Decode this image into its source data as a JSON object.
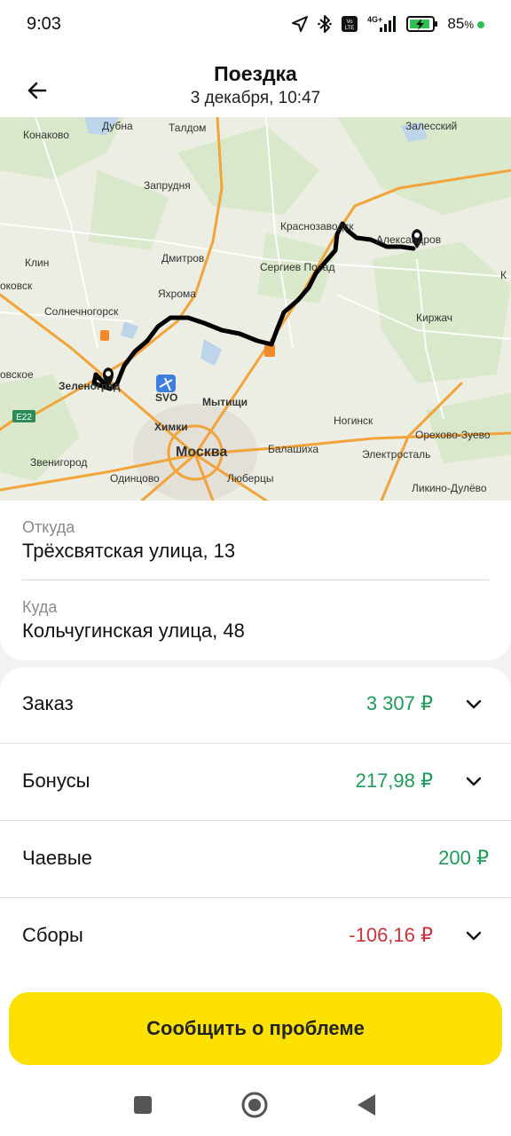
{
  "status_bar": {
    "time": "9:03",
    "battery_percent": "85",
    "battery_unit": "%",
    "icons": [
      "location-arrow-icon",
      "bluetooth-icon",
      "volte-icon",
      "signal-4g-icon",
      "battery-charging-icon"
    ]
  },
  "header": {
    "title": "Поездка",
    "subtitle": "3 декабря, 10:47"
  },
  "map": {
    "labels": {
      "konakovo": "Конаково",
      "dubna": "Дубна",
      "taldom": "Талдом",
      "zalesskiy": "Залесский",
      "zaprudnya": "Запрудня",
      "krasnozavodsk": "Краснозаводск",
      "aleksandrov": "Александров",
      "klin": "Клин",
      "dmitrov": "Дмитров",
      "sergiev_posad": "Сергиев Посад",
      "yahroma": "Яхрома",
      "okovsk": "оковск",
      "solnechnogorsk": "Солнечногорск",
      "kirzhach": "Киржач",
      "ovskoe": "овское",
      "zelenograd": "Зеленоград",
      "svo": "SVO",
      "mytishchi": "Мытищи",
      "khimki": "Химки",
      "e22": "E22",
      "noginsk": "Ногинск",
      "moskva": "Москва",
      "balashikha": "Балашиха",
      "orekhovo": "Орехово-Зуево",
      "zvenigorod": "Звенигород",
      "elektrostal": "Электросталь",
      "odintsovo": "Одинцово",
      "lyubertsy": "Люберцы",
      "likino": "Ликино-Дулёво",
      "k_edge": "К"
    },
    "route_color": "#000000",
    "road_color": "#f2a33a"
  },
  "trip": {
    "from_label": "Откуда",
    "from_value": "Трёхсвятская улица, 13",
    "to_label": "Куда",
    "to_value": "Кольчугинская улица, 48"
  },
  "payments": [
    {
      "label": "Заказ",
      "value": "3 307 ₽",
      "color": "green",
      "expandable": true
    },
    {
      "label": "Бонусы",
      "value": "217,98 ₽",
      "color": "green",
      "expandable": true
    },
    {
      "label": "Чаевые",
      "value": "200 ₽",
      "color": "green",
      "expandable": false
    },
    {
      "label": "Сборы",
      "value": "-106,16 ₽",
      "color": "red",
      "expandable": true
    }
  ],
  "actions": {
    "report_problem": "Сообщить о проблеме"
  },
  "colors": {
    "accent_yellow": "#fce000",
    "value_green": "#1f9a57",
    "value_red": "#c8333d"
  },
  "nav": {
    "icons": [
      "recent-apps-icon",
      "home-icon",
      "back-nav-icon"
    ]
  }
}
